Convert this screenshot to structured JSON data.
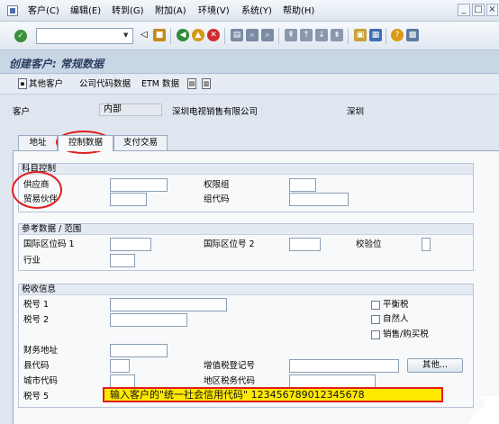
{
  "menubar": {
    "items": [
      "客户(C)",
      "编辑(E)",
      "转到(G)",
      "附加(A)",
      "环境(V)",
      "系统(Y)",
      "帮助(H)"
    ]
  },
  "toolbar": {
    "command_value": ""
  },
  "page_title": "创建客户: 常规数据",
  "app_toolbar": {
    "other_customer": "其他客户",
    "company_code_data": "公司代码数据",
    "etm_data": "ETM 数据"
  },
  "header": {
    "customer_label": "客户",
    "customer_value": "内部",
    "customer_name": "深圳电视销售有限公司",
    "city": "深圳"
  },
  "tabs": [
    "地址",
    "控制数据",
    "支付交易"
  ],
  "account_control": {
    "title": "科目控制",
    "vendor_label": "供应商",
    "trading_partner_label": "贸易伙伴",
    "authorization_label": "权限组",
    "group_key_label": "组代码"
  },
  "reference_data": {
    "title": "参考数据 / 范围",
    "location1_label": "国际区位码 1",
    "location2_label": "国际区位号 2",
    "check_digit_label": "校验位",
    "industry_label": "行业"
  },
  "tax_info": {
    "title": "税收信息",
    "tax1_label": "税号 1",
    "tax2_label": "税号 2",
    "equalization_tax_label": "平衡税",
    "natural_person_label": "自然人",
    "sales_purchase_tax_label": "销售/购买税",
    "fiscal_address_label": "财务地址",
    "county_code_label": "县代码",
    "city_code_label": "城市代码",
    "vat_reg_label": "增值税登记号",
    "regional_tax_code_label": "地区税务代码",
    "other_button": "其他...",
    "tax5_label": "税号 5",
    "tax5_value": "输入客户的\"统一社会信用代码\" 123456789012345678"
  }
}
